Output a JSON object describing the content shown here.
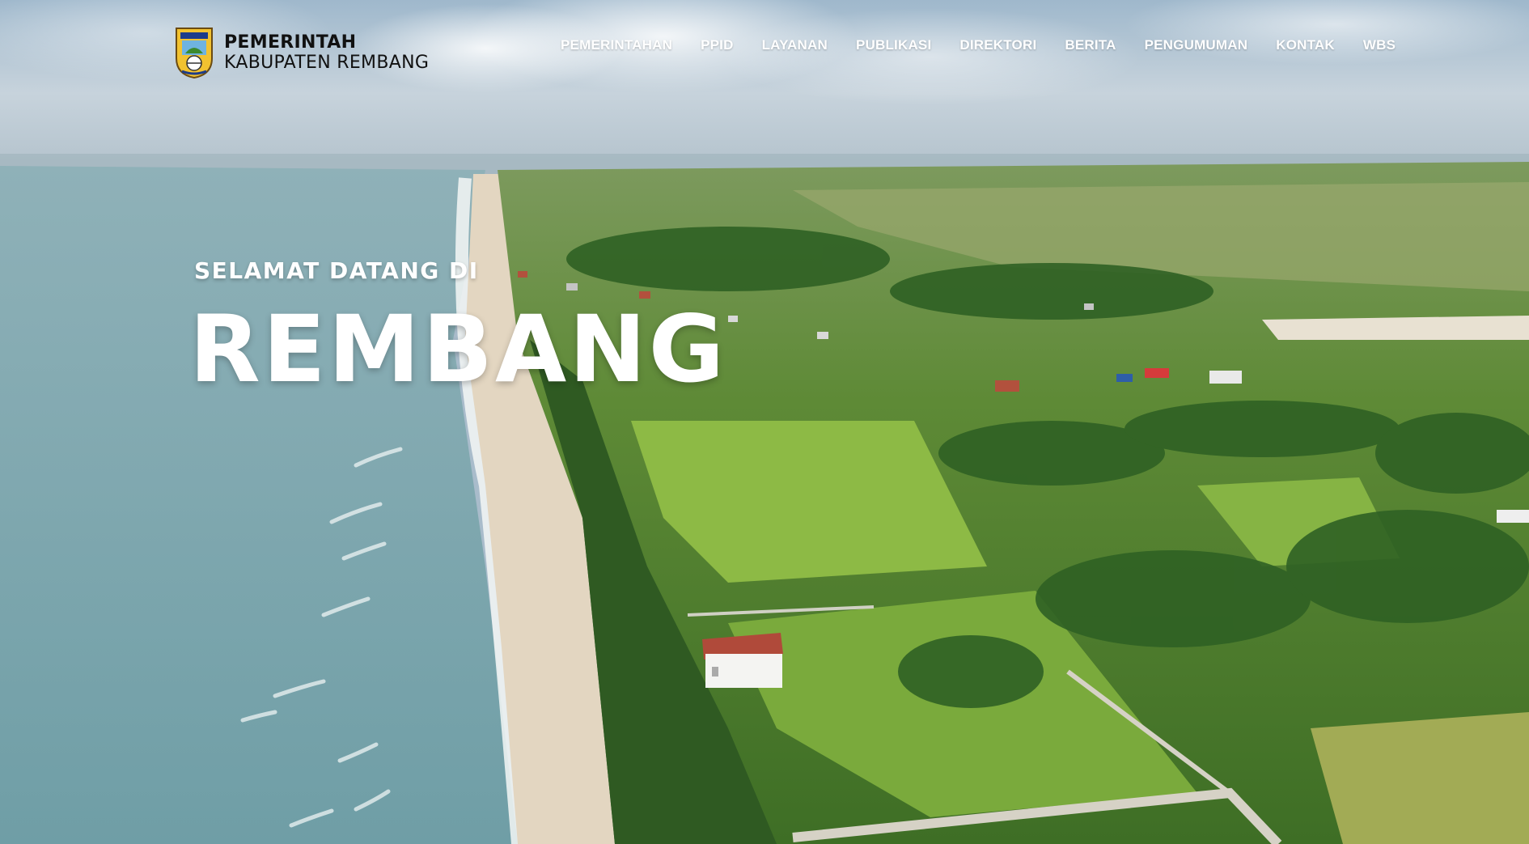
{
  "header": {
    "logo": {
      "line1": "PEMERINTAH",
      "line2": "KABUPATEN REMBANG",
      "emblem_icon": "rembang-regency-coat-of-arms-icon"
    },
    "nav": [
      {
        "label": "PEMERINTAHAN"
      },
      {
        "label": "PPID"
      },
      {
        "label": "LAYANAN"
      },
      {
        "label": "PUBLIKASI"
      },
      {
        "label": "DIREKTORI"
      },
      {
        "label": "BERITA"
      },
      {
        "label": "PENGUMUMAN"
      },
      {
        "label": "KONTAK"
      },
      {
        "label": "WBS"
      }
    ]
  },
  "hero": {
    "welcome": "SELAMAT DATANG DI",
    "title": "REMBANG"
  },
  "colors": {
    "sky": "#b9c9d6",
    "sea": "#7fa8ac",
    "sand": "#e7dbc8",
    "vegetation": "#4c7a2e",
    "text": "#ffffff"
  }
}
